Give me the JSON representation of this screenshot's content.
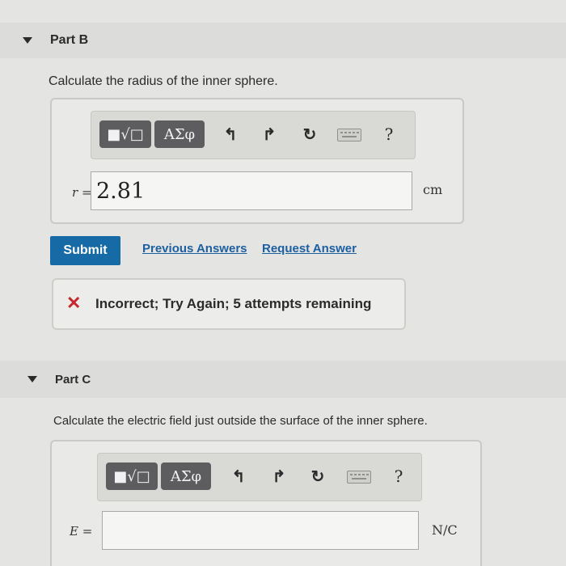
{
  "partB": {
    "title": "Part B",
    "question": "Calculate the radius of the inner sphere.",
    "toolbar": {
      "templates_label": "■√□",
      "greek_label": "ΑΣφ",
      "help_label": "?"
    },
    "variable": "r =",
    "value": "2.81",
    "unit": "cm",
    "submit_label": "Submit",
    "previous_answers_label": "Previous Answers",
    "request_answer_label": "Request Answer",
    "feedback": "Incorrect; Try Again; 5 attempts remaining"
  },
  "partC": {
    "title": "Part C",
    "question": "Calculate the electric field just outside the surface of the inner sphere.",
    "toolbar": {
      "templates_label": "■√□",
      "greek_label": "ΑΣφ",
      "help_label": "?"
    },
    "variable": "E =",
    "value": "",
    "unit": "N/C"
  },
  "colors": {
    "submit": "#166aa5",
    "link": "#1d5fa0",
    "error": "#c8262c"
  }
}
